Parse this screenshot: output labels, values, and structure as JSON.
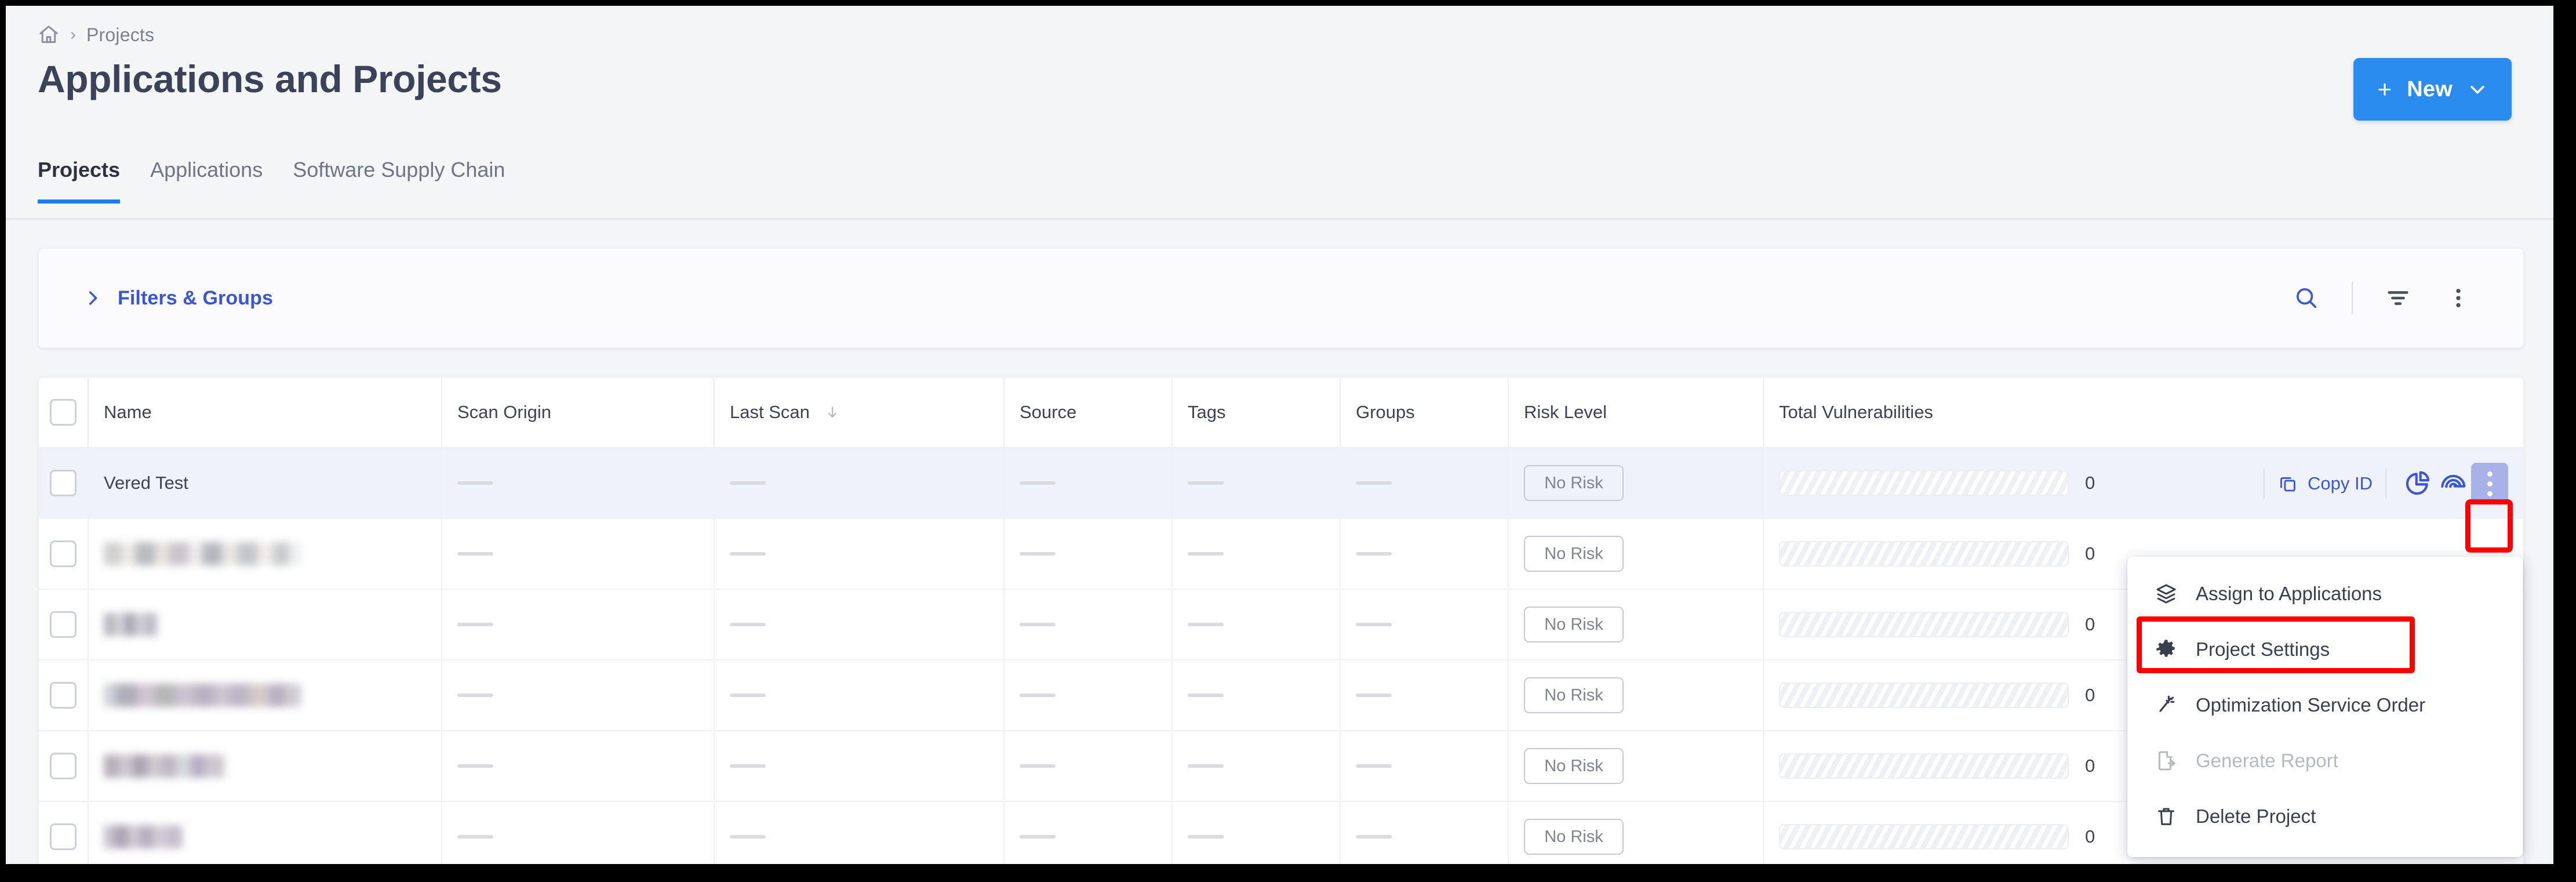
{
  "breadcrumb": {
    "home_icon": "home-icon",
    "separator": "›",
    "current": "Projects"
  },
  "header": {
    "title": "Applications and Projects"
  },
  "new_button": {
    "plus": "+",
    "label": "New",
    "caret_icon": "chevron-down-icon"
  },
  "tabs": [
    {
      "label": "Projects",
      "active": true
    },
    {
      "label": "Applications",
      "active": false
    },
    {
      "label": "Software Supply Chain",
      "active": false
    }
  ],
  "filters": {
    "label": "Filters & Groups",
    "expand_icon": "chevron-right-icon",
    "search_icon": "search-icon",
    "filter_icon": "filter-icon",
    "more_icon": "more-vertical-icon"
  },
  "table": {
    "columns": [
      {
        "key": "checkbox",
        "label": ""
      },
      {
        "key": "name",
        "label": "Name"
      },
      {
        "key": "scan_origin",
        "label": "Scan Origin"
      },
      {
        "key": "last_scan",
        "label": "Last Scan",
        "sorted": true,
        "sort_icon": "arrow-down-icon"
      },
      {
        "key": "source",
        "label": "Source"
      },
      {
        "key": "tags",
        "label": "Tags"
      },
      {
        "key": "groups",
        "label": "Groups"
      },
      {
        "key": "risk_level",
        "label": "Risk Level"
      },
      {
        "key": "total_vulnerabilities",
        "label": "Total Vulnerabilities"
      }
    ],
    "empty_value": "—",
    "rows": [
      {
        "name": "Vered Test",
        "redacted": false,
        "blur_class": "",
        "scan_origin": "—",
        "last_scan": "—",
        "source": "—",
        "tags": "—",
        "groups": "—",
        "risk_level": "No Risk",
        "total_vulnerabilities": "0",
        "selected": true
      },
      {
        "name": "",
        "redacted": true,
        "blur_class": "b1",
        "scan_origin": "—",
        "last_scan": "—",
        "source": "—",
        "tags": "—",
        "groups": "—",
        "risk_level": "No Risk",
        "total_vulnerabilities": "0",
        "selected": false
      },
      {
        "name": "",
        "redacted": true,
        "blur_class": "b2",
        "scan_origin": "—",
        "last_scan": "—",
        "source": "—",
        "tags": "—",
        "groups": "—",
        "risk_level": "No Risk",
        "total_vulnerabilities": "0",
        "selected": false
      },
      {
        "name": "",
        "redacted": true,
        "blur_class": "b3",
        "scan_origin": "—",
        "last_scan": "—",
        "source": "—",
        "tags": "—",
        "groups": "—",
        "risk_level": "No Risk",
        "total_vulnerabilities": "0",
        "selected": false
      },
      {
        "name": "",
        "redacted": true,
        "blur_class": "b4",
        "scan_origin": "—",
        "last_scan": "—",
        "source": "—",
        "tags": "—",
        "groups": "—",
        "risk_level": "No Risk",
        "total_vulnerabilities": "0",
        "selected": false
      },
      {
        "name": "",
        "redacted": true,
        "blur_class": "b5",
        "scan_origin": "—",
        "last_scan": "—",
        "source": "—",
        "tags": "—",
        "groups": "—",
        "risk_level": "No Risk",
        "total_vulnerabilities": "0",
        "selected": false
      }
    ]
  },
  "row_actions": {
    "copy_id_label": "Copy ID",
    "copy_icon": "copy-icon",
    "chart_icon": "pie-chart-icon",
    "fingerprint_icon": "fingerprint-icon",
    "kebab_icon": "more-vertical-icon"
  },
  "context_menu": {
    "items": [
      {
        "label": "Assign to Applications",
        "icon": "layers-icon",
        "disabled": false,
        "highlighted": false
      },
      {
        "label": "Project Settings",
        "icon": "gear-icon",
        "disabled": false,
        "highlighted": true
      },
      {
        "label": "Optimization Service Order",
        "icon": "magic-wand-icon",
        "disabled": false,
        "highlighted": false
      },
      {
        "label": "Generate Report",
        "icon": "export-file-icon",
        "disabled": true,
        "highlighted": false
      },
      {
        "label": "Delete Project",
        "icon": "trash-icon",
        "disabled": false,
        "highlighted": false
      }
    ]
  },
  "colors": {
    "accent_blue": "#2b8cf0",
    "link_blue": "#3a55d6",
    "tab_underline": "#1a7fec",
    "highlight_red": "#ff0000",
    "selected_row": "#eff1fb",
    "kebab_active_bg": "#a9b2e8"
  }
}
